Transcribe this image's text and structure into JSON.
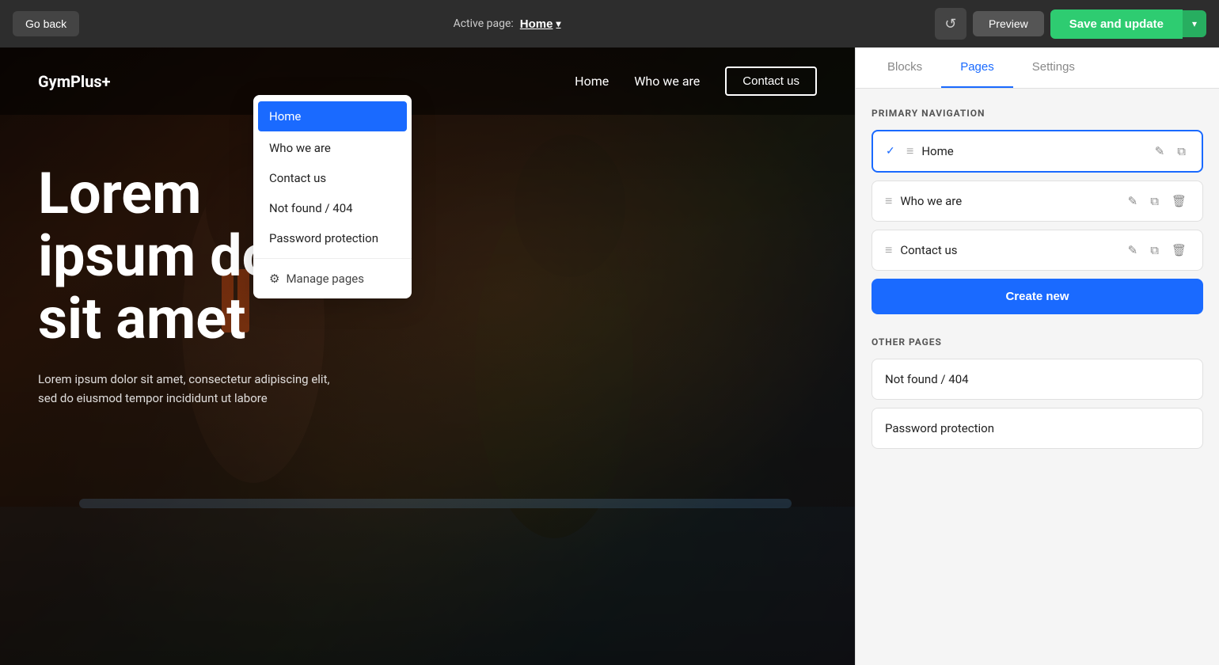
{
  "topbar": {
    "go_back_label": "Go back",
    "active_page_label": "Active page:",
    "active_page_value": "Home",
    "history_icon": "↺",
    "preview_label": "Preview",
    "save_update_label": "Save and update",
    "save_arrow": "▾"
  },
  "dropdown": {
    "items": [
      {
        "id": "home",
        "label": "Home",
        "active": true
      },
      {
        "id": "who-we-are",
        "label": "Who we are",
        "active": false
      },
      {
        "id": "contact-us",
        "label": "Contact us",
        "active": false
      },
      {
        "id": "not-found",
        "label": "Not found / 404",
        "active": false
      },
      {
        "id": "password-protection",
        "label": "Password protection",
        "active": false
      }
    ],
    "manage_pages_label": "Manage pages",
    "gear_icon": "⚙"
  },
  "site_preview": {
    "logo": "GymPlus+",
    "nav_links": [
      "Home",
      "Who we are",
      "Contact us"
    ],
    "hero_title": "Lorem ipsum dolor sit amet",
    "hero_description": "Lorem ipsum dolor sit amet, consectetur adipiscing elit, sed do eiusmod tempor incididunt ut labore",
    "body_alt_text": "Athlete training photo"
  },
  "right_panel": {
    "tabs": [
      {
        "id": "blocks",
        "label": "Blocks"
      },
      {
        "id": "pages",
        "label": "Pages",
        "active": true
      },
      {
        "id": "settings",
        "label": "Settings"
      }
    ],
    "primary_navigation_label": "PRIMARY NAVIGATION",
    "nav_pages": [
      {
        "id": "home",
        "label": "Home",
        "active": true
      },
      {
        "id": "who-we-are",
        "label": "Who we are",
        "active": false
      },
      {
        "id": "contact-us",
        "label": "Contact us",
        "active": false
      }
    ],
    "create_new_label": "Create new",
    "other_pages_label": "OTHER PAGES",
    "other_pages": [
      {
        "id": "not-found",
        "label": "Not found / 404"
      },
      {
        "id": "password-protection",
        "label": "Password protection"
      }
    ],
    "edit_icon": "✎",
    "copy_icon": "⧉",
    "delete_icon": "🗑",
    "drag_icon": "≡",
    "check_icon": "✓"
  }
}
